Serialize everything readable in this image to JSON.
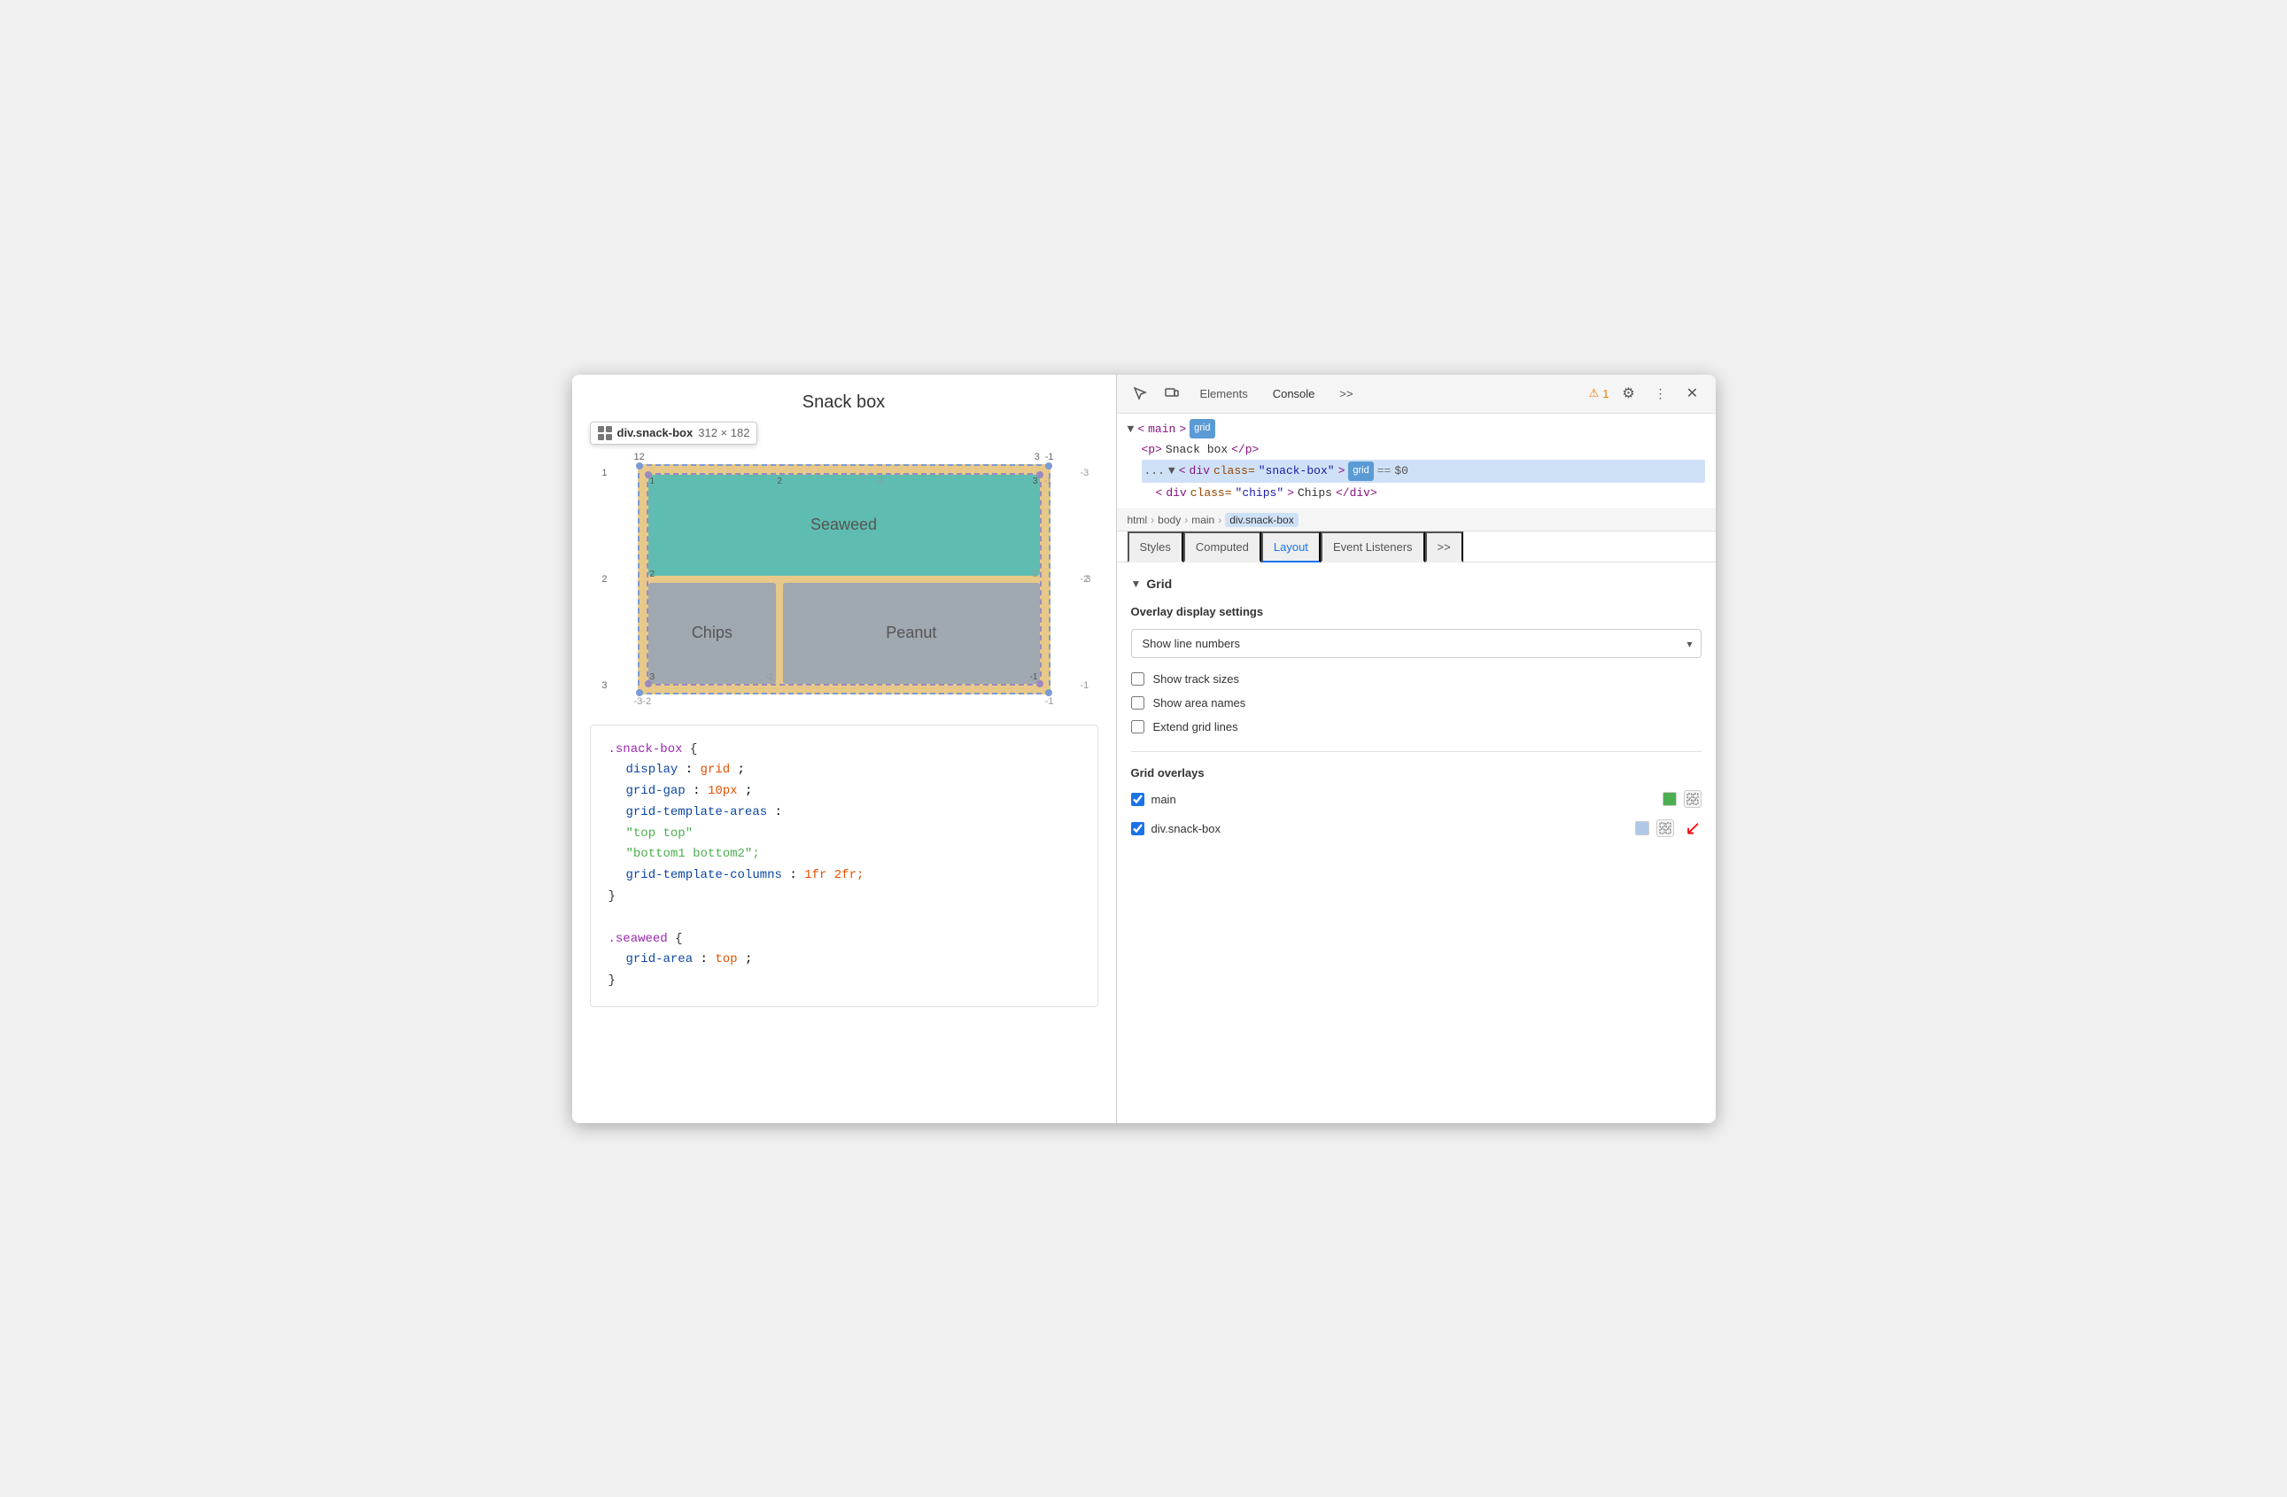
{
  "window": {
    "title": "Snack box"
  },
  "left_panel": {
    "page_title": "Snack box",
    "tooltip": {
      "class": "div.snack-box",
      "size": "312 × 182"
    },
    "grid_labels": {
      "top": [
        "1",
        "2",
        "3"
      ],
      "bottom": [
        "-3",
        "-2",
        "-1"
      ],
      "left": [
        "1",
        "2",
        "3"
      ],
      "right": [
        "-3",
        "-2",
        "-1"
      ],
      "inner_top": [
        "1",
        "2",
        "3"
      ],
      "inner_left": [
        "1",
        "2",
        "3"
      ],
      "inner_right": [
        "-3",
        "-2",
        "-1"
      ],
      "inner_bottom": [
        "-3",
        "-2",
        "-1"
      ]
    },
    "cells": {
      "seaweed": "Seaweed",
      "chips": "Chips",
      "peanut": "Peanut"
    },
    "css": {
      "selector1": ".snack-box",
      "prop1": "display",
      "val1": "grid",
      "prop2": "grid-gap",
      "val2": "10px",
      "prop3": "grid-template-areas",
      "str1": "\"top top\"",
      "str2": "\"bottom1 bottom2\";",
      "prop4": "grid-template-columns",
      "val4": "1fr 2fr;",
      "selector2": ".seaweed",
      "prop5": "grid-area",
      "val5": "top"
    }
  },
  "devtools": {
    "tabs": [
      "Elements",
      "Console",
      ">>"
    ],
    "warning_count": "1",
    "dom": {
      "main_tag": "<main>",
      "main_badge": "grid",
      "p_tag": "<p>Snack box</p>",
      "div_snack_box": "<div class=\"snack-box\">",
      "div_snack_box_badge": "grid",
      "div_snack_box_equals": "== $0",
      "div_chips": "<div class=\"chips\">Chips</div>"
    },
    "breadcrumb": [
      "html",
      "body",
      "main",
      "div.snack-box"
    ],
    "panel_tabs": [
      "Styles",
      "Computed",
      "Layout",
      "Event Listeners",
      ">>"
    ],
    "active_panel_tab": "Layout",
    "layout": {
      "section_title": "Grid",
      "overlay_settings_title": "Overlay display settings",
      "dropdown_value": "Show line numbers",
      "dropdown_options": [
        "Show line numbers",
        "Show track sizes",
        "Show area names"
      ],
      "checkbox_track_sizes": "Show track sizes",
      "checkbox_area_names": "Show area names",
      "checkbox_extend": "Extend grid lines",
      "grid_overlays_title": "Grid overlays",
      "overlays": [
        {
          "checked": true,
          "label": "main",
          "color": "#4caf50"
        },
        {
          "checked": true,
          "label": "div.snack-box",
          "color": "#b0c8e8"
        }
      ]
    }
  }
}
